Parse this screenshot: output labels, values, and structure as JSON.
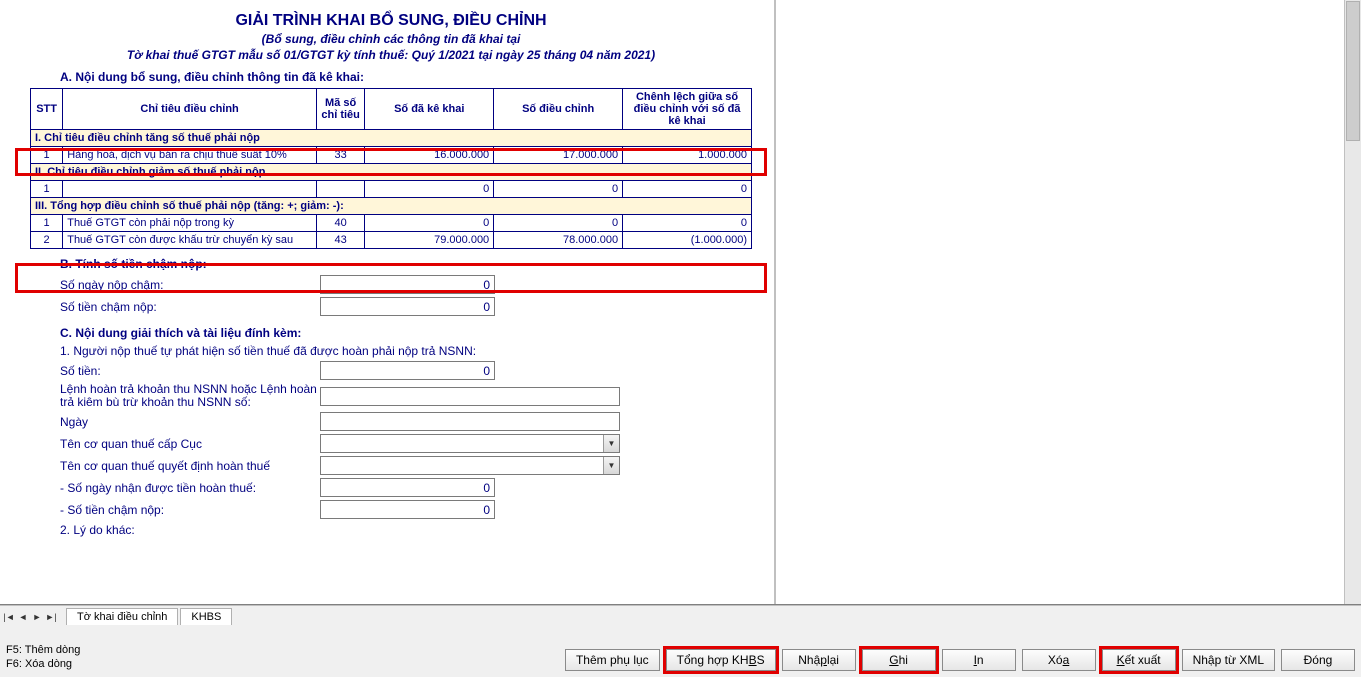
{
  "title_main": "GIẢI TRÌNH KHAI BỔ SUNG, ĐIỀU CHỈNH",
  "title_sub1": "(Bổ sung, điều chỉnh các thông tin đã khai tại",
  "title_sub2": "Tờ khai thuế GTGT mẫu số 01/GTGT kỳ tính thuế: Quý 1/2021 tại ngày 25 tháng 04 năm 2021)",
  "sectionA": "A. Nội dung bổ sung, điều chỉnh thông tin đã kê khai:",
  "headers": {
    "stt": "STT",
    "chi": "Chỉ tiêu điều chỉnh",
    "ma": "Mã số chỉ tiêu",
    "kekhai": "Số đã kê khai",
    "dieuchinh": "Số điều chỉnh",
    "chenh": "Chênh lệch giữa số điều chỉnh với số đã kê khai"
  },
  "group1": "I. Chỉ tiêu điều chỉnh tăng số thuế phải nộp",
  "row1": {
    "stt": "1",
    "chi": "Hàng hoá, dịch vụ bán ra chịu thuế suất 10%",
    "ma": "33",
    "kekhai": "16.000.000",
    "dieuchinh": "17.000.000",
    "chenh": "1.000.000"
  },
  "group2": "II. Chỉ tiêu điều chỉnh giảm số thuế phải nộp",
  "row2": {
    "stt": "1",
    "chi": "",
    "ma": "",
    "kekhai": "0",
    "dieuchinh": "0",
    "chenh": "0"
  },
  "group3": "III. Tổng hợp điều chỉnh số thuế phải nộp (tăng: +; giảm: -):",
  "row3a": {
    "stt": "1",
    "chi": "Thuế GTGT còn phải nộp trong kỳ",
    "ma": "40",
    "kekhai": "0",
    "dieuchinh": "0",
    "chenh": "0"
  },
  "row3b": {
    "stt": "2",
    "chi": "Thuế GTGT còn được khấu trừ chuyển kỳ sau",
    "ma": "43",
    "kekhai": "79.000.000",
    "dieuchinh": "78.000.000",
    "chenh": "(1.000.000)"
  },
  "sectionB": "B. Tính số tiền chậm nộp:",
  "lbl_songay": "Số ngày nộp chậm:",
  "val_songay": "0",
  "lbl_sotien": "Số tiền chậm nộp:",
  "val_sotien": "0",
  "sectionC": "C. Nội dung giải thích và tài liệu đính kèm:",
  "c1": "1. Người nộp thuế tự phát hiện số tiền thuế đã được hoàn phải nộp trả NSNN:",
  "c_sotien_lbl": "Số tiền:",
  "c_sotien_val": "0",
  "c_lenh": "Lệnh hoàn trả khoản thu NSNN hoặc Lệnh hoàn trả kiêm bù trừ khoản thu NSNN số:",
  "c_ngay": "Ngày",
  "c_cqt_cuc": "Tên cơ quan thuế cấp Cục",
  "c_cqt_qd": "Tên cơ quan thuế quyết định hoàn thuế",
  "c_songaynhan": "- Số ngày nhận được tiền hoàn thuế:",
  "c_songaynhan_val": "0",
  "c_sotiencham": "- Số tiền chậm nộp:",
  "c_sotiencham_val": "0",
  "c_lydo": "2. Lý do khác:",
  "tabs": {
    "t1": "Tờ khai điều chỉnh",
    "t2": "KHBS"
  },
  "hints": {
    "f5": "F5: Thêm dòng",
    "f6": "F6: Xóa dòng"
  },
  "buttons": {
    "themphuluc": "Thêm phụ lục",
    "tonghop_pre": "Tổng hợp KH",
    "tonghop_u": "B",
    "tonghop_post": "S",
    "nhaplai_pre": "Nhậ",
    "nhaplai_u": "p",
    "nhaplai_post": " lại",
    "ghi_u": "G",
    "ghi_post": "hi",
    "in_u": "I",
    "in_post": "n",
    "xoa_pre": "Xó",
    "xoa_u": "a",
    "ketxuat_u": "K",
    "ketxuat_post": "ết xuất",
    "nhapxml": "Nhập từ XML",
    "dong_pre": "Đón",
    "dong_u": "g"
  }
}
